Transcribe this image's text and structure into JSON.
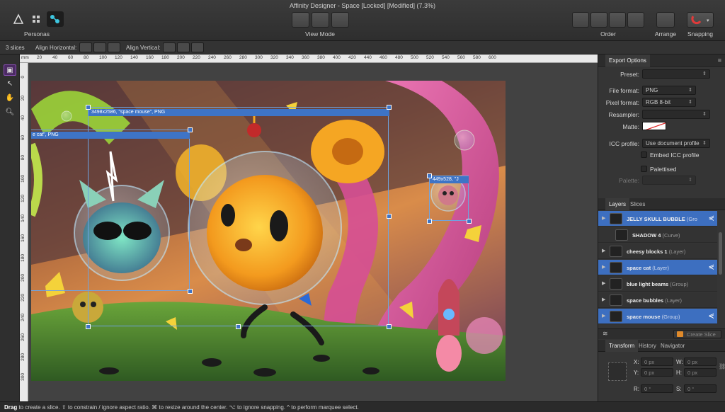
{
  "window": {
    "title": "Affinity Designer - Space [Locked] [Modified] (7.3%)"
  },
  "toolbar": {
    "personas_label": "Personas",
    "view_mode_label": "View Mode",
    "order_label": "Order",
    "arrange_label": "Arrange",
    "snapping_label": "Snapping"
  },
  "context_bar": {
    "slice_count": "3 slices",
    "align_horizontal_label": "Align Horizontal:",
    "align_vertical_label": "Align Vertical:"
  },
  "ruler": {
    "h_ticks": [
      "20",
      "40",
      "60",
      "80",
      "100",
      "120",
      "140",
      "160",
      "180",
      "200",
      "220",
      "240",
      "260",
      "280",
      "300",
      "320",
      "340",
      "360",
      "380",
      "400",
      "420",
      "440",
      "460",
      "480",
      "500",
      "520",
      "540",
      "560",
      "580",
      "600"
    ],
    "v_ticks": [
      "0",
      "20",
      "40",
      "60",
      "80",
      "100",
      "120",
      "140",
      "160",
      "180",
      "200",
      "220",
      "240",
      "260",
      "280",
      "300"
    ],
    "unit": "mm"
  },
  "canvas": {
    "slices": [
      {
        "label": "3498x2586, \"space mouse\", PNG"
      },
      {
        "label": "e cat\", PNG"
      },
      {
        "label": "449x528, \"J"
      }
    ]
  },
  "export_options": {
    "tab_label": "Export Options",
    "preset_label": "Preset:",
    "preset_value": "",
    "file_format_label": "File format:",
    "file_format_value": "PNG",
    "pixel_format_label": "Pixel format:",
    "pixel_format_value": "RGB 8-bit",
    "resampler_label": "Resampler:",
    "resampler_value": "",
    "matte_label": "Matte:",
    "icc_profile_label": "ICC profile:",
    "icc_profile_value": "Use document profile",
    "embed_icc_label": "Embed ICC profile",
    "palettised_label": "Palettised",
    "palette_label": "Palette:"
  },
  "layers_panel": {
    "tabs": [
      "Layers",
      "Slices"
    ],
    "items": [
      {
        "name": "JELLY SKULL BUBBLE",
        "kind": "(Gro",
        "selected": true
      },
      {
        "name": "SHADOW 4",
        "kind": "(Curve)",
        "selected": false
      },
      {
        "name": "cheesy blocks 1",
        "kind": "(Layer)",
        "selected": false
      },
      {
        "name": "space cat",
        "kind": "(Layer)",
        "selected": true
      },
      {
        "name": "blue light beams",
        "kind": "(Group)",
        "selected": false
      },
      {
        "name": "space bubbles",
        "kind": "(Layer)",
        "selected": false
      },
      {
        "name": "space mouse",
        "kind": "(Group)",
        "selected": true
      }
    ],
    "create_slice_label": "Create Slice"
  },
  "transform_panel": {
    "tabs": [
      "Transform",
      "History",
      "Navigator"
    ],
    "x_label": "X:",
    "x_value": "0 px",
    "y_label": "Y:",
    "y_value": "0 px",
    "w_label": "W:",
    "w_value": "0 px",
    "h_label": "H:",
    "h_value": "0 px",
    "r_label": "R:",
    "r_value": "0 °",
    "s_label": "S:",
    "s_value": "0 °"
  },
  "status": {
    "drag_word": "Drag",
    "text": " to create a slice. ⇧ to constrain / ignore aspect ratio. ⌘ to resize around the center. ⌥ to ignore snapping. ^ to perform marquee select."
  },
  "colors": {
    "accent": "#3e74c6",
    "panel": "#353535",
    "toolbar": "#333333"
  }
}
